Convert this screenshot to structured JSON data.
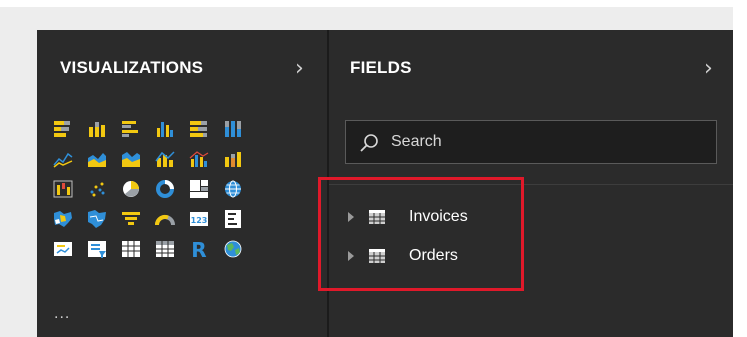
{
  "visualizations": {
    "title": "VISUALIZATIONS",
    "more_label": "...",
    "icons": [
      {
        "name": "stacked-bar-chart-icon"
      },
      {
        "name": "stacked-column-chart-icon"
      },
      {
        "name": "clustered-bar-chart-icon"
      },
      {
        "name": "clustered-column-chart-icon"
      },
      {
        "name": "100-stacked-bar-chart-icon"
      },
      {
        "name": "100-stacked-column-chart-icon"
      },
      {
        "name": "line-chart-icon"
      },
      {
        "name": "area-chart-icon"
      },
      {
        "name": "stacked-area-chart-icon"
      },
      {
        "name": "line-and-stacked-column-chart-icon"
      },
      {
        "name": "line-and-clustered-column-chart-icon"
      },
      {
        "name": "ribbon-chart-icon"
      },
      {
        "name": "waterfall-chart-icon"
      },
      {
        "name": "scatter-chart-icon"
      },
      {
        "name": "pie-chart-icon"
      },
      {
        "name": "donut-chart-icon"
      },
      {
        "name": "treemap-icon"
      },
      {
        "name": "map-icon"
      },
      {
        "name": "filled-map-icon"
      },
      {
        "name": "shape-map-icon"
      },
      {
        "name": "funnel-icon"
      },
      {
        "name": "gauge-icon"
      },
      {
        "name": "card-icon",
        "text": "123"
      },
      {
        "name": "multi-row-card-icon"
      },
      {
        "name": "kpi-icon"
      },
      {
        "name": "slicer-icon"
      },
      {
        "name": "table-icon"
      },
      {
        "name": "matrix-icon"
      },
      {
        "name": "r-script-visual-icon",
        "text": "R"
      },
      {
        "name": "arcgis-map-icon"
      }
    ]
  },
  "fields": {
    "title": "FIELDS",
    "search_placeholder": "Search",
    "items": [
      {
        "label": "Invoices"
      },
      {
        "label": "Orders"
      }
    ]
  },
  "colors": {
    "pane_bg": "#2b2b2b",
    "accent_yellow": "#f2c811",
    "accent_blue": "#2f8fd8",
    "highlight_red": "#e0192a"
  }
}
